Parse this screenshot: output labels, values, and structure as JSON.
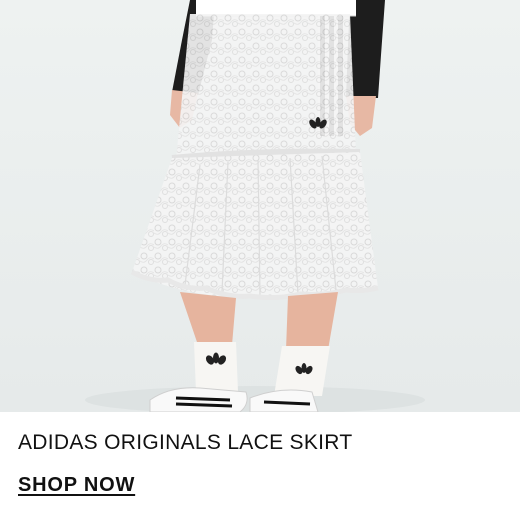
{
  "product": {
    "title": "ADIDAS ORIGINALS LACE SKIRT",
    "cta_label": "SHOP NOW",
    "image_subject": "lace-skirt-product-photo"
  },
  "colors": {
    "background": "#ffffff",
    "photo_background": "#eef1f1",
    "text": "#111111"
  }
}
